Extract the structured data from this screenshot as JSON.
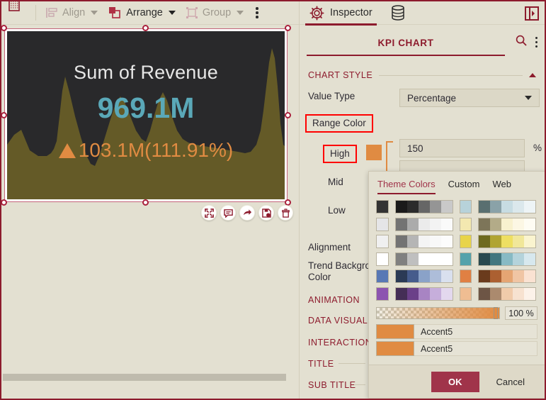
{
  "toolbar": {
    "trash_icon": "trash-icon",
    "align": {
      "label": "Align",
      "icon": "align-icon"
    },
    "arrange": {
      "label": "Arrange",
      "icon": "arrange-icon"
    },
    "group": {
      "label": "Group",
      "icon": "group-icon"
    },
    "more_icon": "kebab-menu-icon"
  },
  "canvas": {
    "kpi": {
      "title": "Sum of Revenue",
      "value": "969.1M",
      "delta": "103.1M(111.91%)",
      "delta_direction": "up-triangle-icon",
      "background": "#29292b",
      "value_color": "#5aa8b8",
      "delta_color": "#e08b42",
      "trend_color": "#645a27"
    },
    "actions": [
      {
        "name": "maximize-button",
        "icon": "expand-icon"
      },
      {
        "name": "comment-button",
        "icon": "comment-icon"
      },
      {
        "name": "share-button",
        "icon": "share-arrow-icon"
      },
      {
        "name": "save-as-button",
        "icon": "save-icon"
      },
      {
        "name": "delete-button",
        "icon": "trash-icon"
      }
    ]
  },
  "panel": {
    "tabs": [
      {
        "label": "Inspector",
        "icon": "gear-icon",
        "selected": true
      },
      {
        "label": "",
        "icon": "database-icon",
        "selected": false
      }
    ],
    "collapse_icon": "panel-toggle-icon",
    "header": {
      "title": "KPI CHART",
      "search_icon": "search-icon",
      "more_icon": "kebab-menu-icon"
    },
    "sections": {
      "chart_style": "CHART STYLE",
      "animation": "ANIMATION",
      "data_visualization": "DATA VISUALIZ",
      "interaction": "INTERACTION",
      "title": "TITLE",
      "sub_title": "SUB TITLE"
    },
    "fields": {
      "value_type_label": "Value Type",
      "value_type_value": "Percentage",
      "range_color_label": "Range Color",
      "high_label": "High",
      "high_value": "150",
      "high_unit": "%",
      "mid_label": "Mid",
      "low_label": "Low",
      "alignment_label": "Alignment",
      "trend_background_label_1": "Trend Backgro",
      "trend_background_label_2": "Color"
    },
    "highlight_color": "#ff0000",
    "accent_color": "#e08b42"
  },
  "color_picker": {
    "tabs": [
      {
        "label": "Theme Colors",
        "selected": true
      },
      {
        "label": "Custom",
        "selected": false
      },
      {
        "label": "Web",
        "selected": false
      }
    ],
    "swatch_rows": [
      {
        "left_base": "#333333",
        "left_run": [
          "#1a1a1a",
          "#2b2b2b",
          "#666666",
          "#959595",
          "#c9c9c9"
        ],
        "right_base": "#b7d2da",
        "right_run": [
          "#596f70",
          "#8aa2a8",
          "#c7dce2",
          "#dbe8ec",
          "#edf4f6"
        ]
      },
      {
        "left_base": "#e5e5e7",
        "left_run": [
          "#737373",
          "#ababab",
          "#ebebeb",
          "#f3f3f3",
          "#fafafa"
        ],
        "right_base": "#f3e8b0",
        "right_run": [
          "#7d7559",
          "#b3ab88",
          "#f8f1cf",
          "#fcf7e4",
          "#fefcf3"
        ]
      },
      {
        "left_base": "#f0f0f0",
        "left_run": [
          "#737373",
          "#b5b5b5",
          "#f4f4f4",
          "#f8f8f8",
          "#fcfcfc"
        ],
        "right_base": "#e8d44a",
        "right_run": [
          "#6e6a1f",
          "#b0a432",
          "#eedf62",
          "#f1e799",
          "#faf4cf"
        ]
      },
      {
        "left_base": "#ffffff",
        "left_run": [
          "#808080",
          "#bfbfbf",
          "#ffffff",
          "#ffffff",
          "#ffffff"
        ],
        "right_base": "#54a2ab",
        "right_run": [
          "#2a4a4f",
          "#42777f",
          "#87bac4",
          "#b4d3db",
          "#d7e8ee"
        ]
      },
      {
        "left_base": "#5878b5",
        "left_run": [
          "#2b3a55",
          "#465c8c",
          "#8aa2c8",
          "#adbdd9",
          "#d9e0ee"
        ],
        "right_base": "#e08043",
        "right_run": [
          "#6a3b1c",
          "#ac6031",
          "#e5a573",
          "#f0c5a4",
          "#fae2d2"
        ]
      },
      {
        "left_base": "#8c54b0",
        "left_run": [
          "#452e56",
          "#6b4089",
          "#a884c3",
          "#c6aedb",
          "#e3d8ee"
        ],
        "right_base": "#efbd92",
        "right_run": [
          "#6d5545",
          "#ab8a6e",
          "#f0cbaa",
          "#f7e2d0",
          "#fcf2e9"
        ]
      }
    ],
    "opacity_value": "100 %",
    "accent_items": [
      {
        "label": "Accent5",
        "color": "#e08b42"
      },
      {
        "label": "Accent5",
        "color": "#e08b42"
      }
    ],
    "ok_label": "OK",
    "cancel_label": "Cancel"
  },
  "chart_data": {
    "type": "area",
    "title": "Sum of Revenue",
    "value": "969.1M",
    "delta": "103.1M(111.91%)",
    "x": [
      0,
      1,
      2,
      3,
      4,
      5,
      6,
      7,
      8,
      9,
      10,
      11,
      12,
      13,
      14,
      15,
      16,
      17,
      18,
      19,
      20
    ],
    "values": [
      46,
      55,
      38,
      30,
      32,
      86,
      22,
      31,
      53,
      80,
      50,
      49,
      78,
      46,
      55,
      57,
      53,
      50,
      48,
      100,
      60
    ],
    "ylim": [
      0,
      100
    ],
    "grid": false,
    "legend": "none"
  }
}
